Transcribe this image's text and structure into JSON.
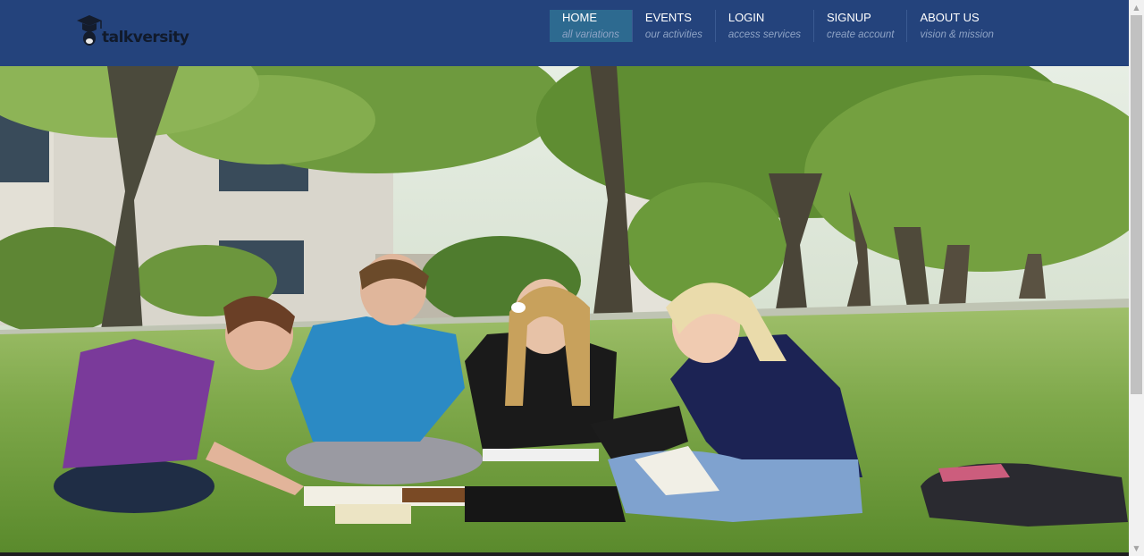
{
  "brand": {
    "logo_text": "talkversity",
    "logo_icon": "graduation-cap-icon"
  },
  "nav": {
    "items": [
      {
        "title": "HOME",
        "subtitle": "all variations",
        "active": true
      },
      {
        "title": "EVENTS",
        "subtitle": "our activities",
        "active": false
      },
      {
        "title": "LOGIN",
        "subtitle": "access services",
        "active": false
      },
      {
        "title": "SIGNUP",
        "subtitle": "create account",
        "active": false
      },
      {
        "title": "ABOUT US",
        "subtitle": "vision & mission",
        "active": false
      }
    ]
  },
  "colors": {
    "navbar_bg": "#24437c",
    "active_item_bg": "#2d6a90",
    "menu_subtitle": "#8fa4c6"
  },
  "scrollbar": {
    "up_icon": "arrow-up-icon",
    "down_icon": "arrow-down-icon"
  }
}
